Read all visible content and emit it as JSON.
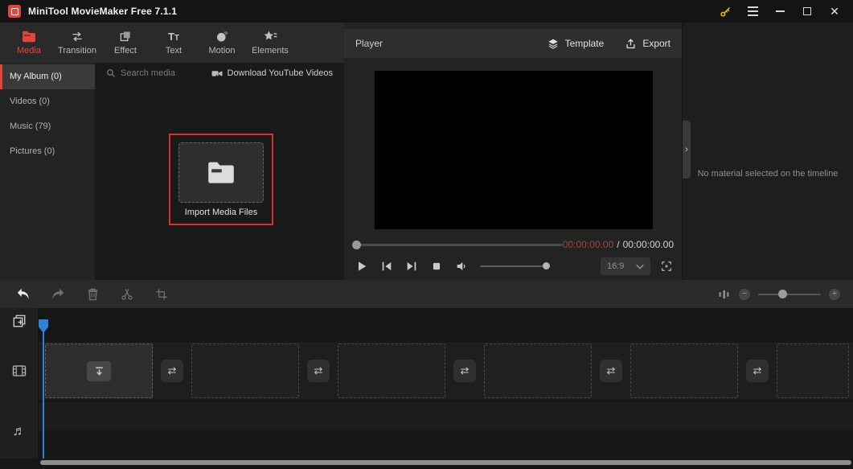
{
  "colors": {
    "accent-red": "#e2463b",
    "annotation-red": "#d6342a",
    "playhead-blue": "#2f81d9",
    "timecode-red": "#9c463e",
    "key-yellow": "#e9b913"
  },
  "titlebar": {
    "title": "MiniTool MovieMaker Free 7.1.1"
  },
  "tabs": [
    {
      "label": "Media",
      "active": true
    },
    {
      "label": "Transition"
    },
    {
      "label": "Effect"
    },
    {
      "label": "Text"
    },
    {
      "label": "Motion"
    },
    {
      "label": "Elements"
    }
  ],
  "library": {
    "sidebar_items": [
      {
        "label": "My Album (0)",
        "active": true
      },
      {
        "label": "Videos (0)"
      },
      {
        "label": "Music (79)"
      },
      {
        "label": "Pictures (0)"
      }
    ],
    "search_placeholder": "Search media",
    "download_youtube_label": "Download YouTube Videos",
    "import_label": "Import Media Files"
  },
  "player": {
    "title": "Player",
    "template_label": "Template",
    "export_label": "Export",
    "current_time": "00:00:00.00",
    "time_separator": "/",
    "total_time": "00:00:00.00",
    "aspect_ratio": "16:9"
  },
  "inspector": {
    "empty_message": "No material selected on the timeline"
  },
  "timeline": {
    "transition_glyph": "⇄",
    "items": [
      {
        "type": "clip",
        "variant": "import"
      },
      {
        "type": "transition"
      },
      {
        "type": "clip"
      },
      {
        "type": "transition"
      },
      {
        "type": "clip"
      },
      {
        "type": "transition"
      },
      {
        "type": "clip"
      },
      {
        "type": "transition"
      },
      {
        "type": "clip"
      },
      {
        "type": "transition"
      },
      {
        "type": "clip",
        "variant": "clipped"
      }
    ]
  }
}
